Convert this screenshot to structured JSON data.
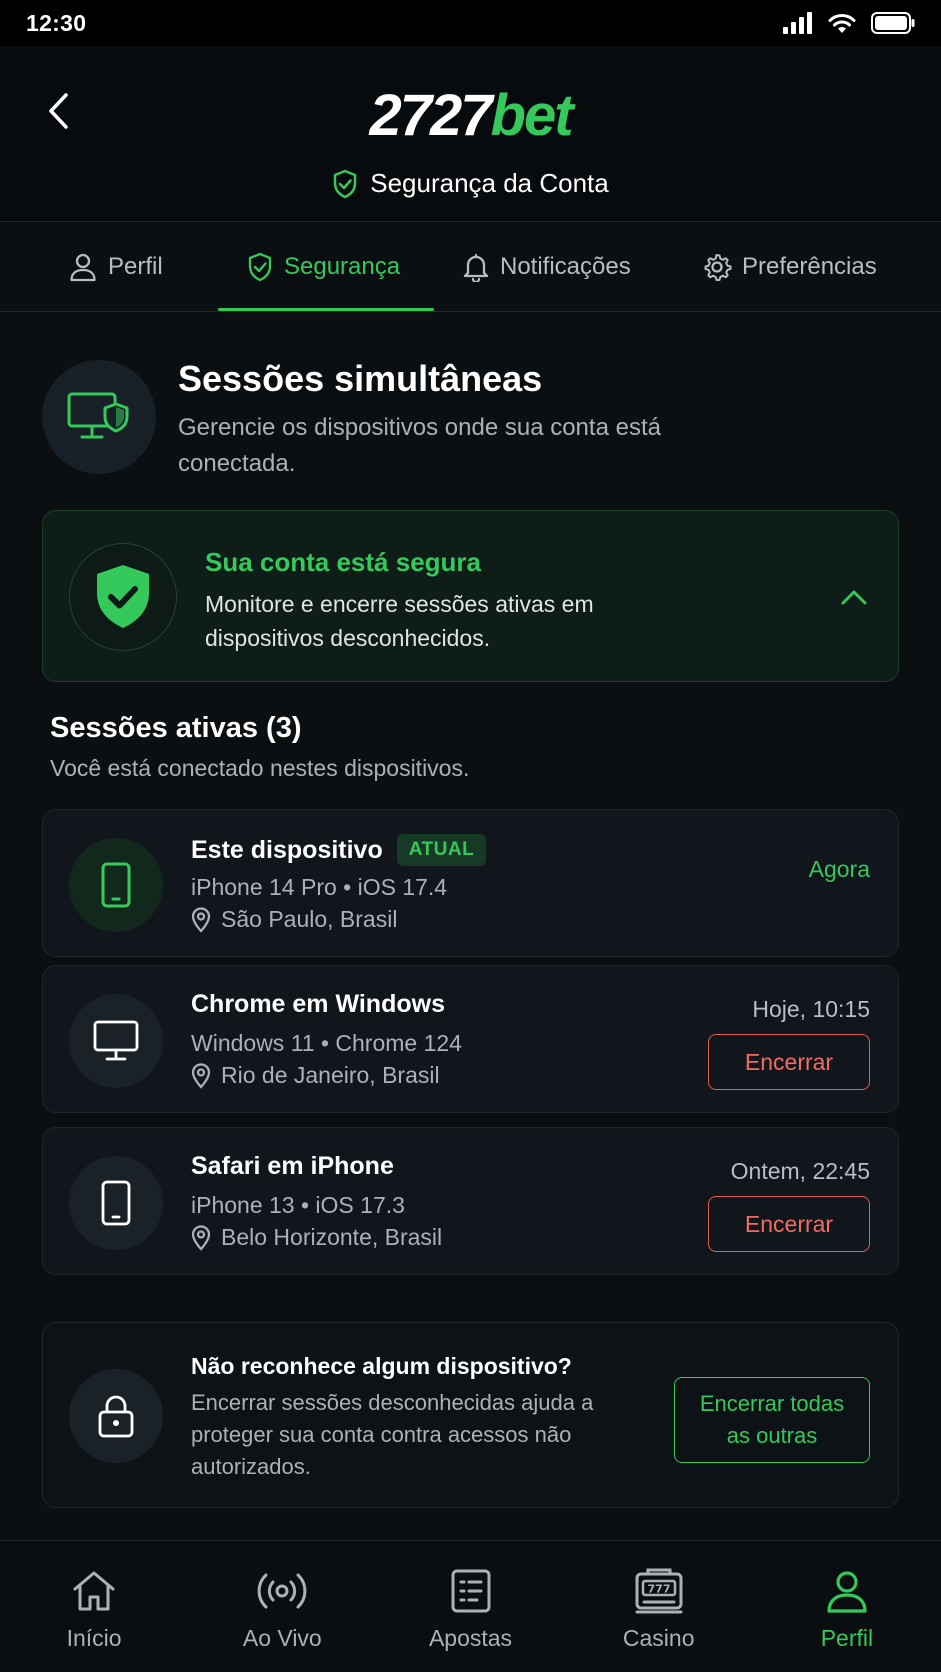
{
  "status_bar": {
    "time": "12:30"
  },
  "header": {
    "logo_num": "2727",
    "logo_bet": "bet",
    "title": "Segurança da Conta"
  },
  "tabs": [
    {
      "label": "Perfil",
      "icon": "user-icon",
      "active": false
    },
    {
      "label": "Segurança",
      "icon": "shield-check-icon",
      "active": true
    },
    {
      "label": "Notificações",
      "icon": "bell-icon",
      "active": false
    },
    {
      "label": "Preferências",
      "icon": "gear-icon",
      "active": false
    }
  ],
  "section": {
    "title": "Sessões simultâneas",
    "subtitle": "Gerencie os dispositivos onde sua conta está conectada."
  },
  "secure_card": {
    "title": "Sua conta está segura",
    "text": "Monitore e encerre sessões ativas em dispositivos desconhecidos."
  },
  "active_sessions": {
    "title": "Sessões ativas (3)",
    "subtitle": "Você está conectado nestes dispositivos.",
    "items": [
      {
        "name": "Este dispositivo",
        "badge": "ATUAL",
        "device": "iPhone 14 Pro • iOS 17.4",
        "location": "São Paulo, Brasil",
        "time": "Agora",
        "icon": "smartphone-icon"
      },
      {
        "name": "Chrome em Windows",
        "device": "Windows 11 • Chrome 124",
        "location": "Rio de Janeiro, Brasil",
        "time": "Hoje, 10:15",
        "action": "Encerrar",
        "icon": "monitor-icon"
      },
      {
        "name": "Safari em iPhone",
        "device": "iPhone 13 • iOS 17.3",
        "location": "Belo Horizonte, Brasil",
        "time": "Ontem, 22:45",
        "action": "Encerrar",
        "icon": "smartphone-icon"
      }
    ]
  },
  "unknown_card": {
    "title": "Não reconhece algum dispositivo?",
    "text": "Encerrar sessões desconhecidas ajuda a proteger sua conta contra acessos não autorizados.",
    "button": "Encerrar todas as outras"
  },
  "bottom_nav": [
    {
      "label": "Início",
      "icon": "home-icon",
      "active": false
    },
    {
      "label": "Ao Vivo",
      "icon": "live-broadcast-icon",
      "active": false
    },
    {
      "label": "Apostas",
      "icon": "betslip-icon",
      "active": false
    },
    {
      "label": "Casino",
      "icon": "slot-machine-icon",
      "active": false
    },
    {
      "label": "Perfil",
      "icon": "user-icon",
      "active": true
    }
  ],
  "colors": {
    "accent": "#35c85a",
    "danger": "#f26b5f",
    "background": "#0b0f12"
  }
}
